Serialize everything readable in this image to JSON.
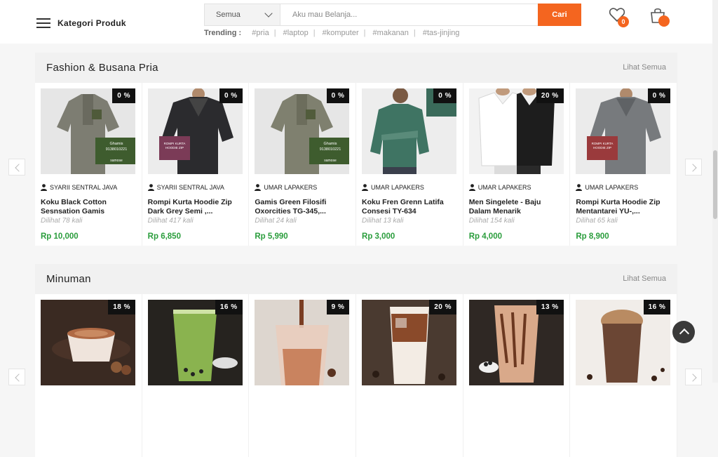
{
  "header": {
    "category_label": "Kategori Produk",
    "search_category": "Semua",
    "search_placeholder": "Aku mau Belanja...",
    "search_button": "Cari",
    "trending_label": "Trending :",
    "trending_tags": [
      "#pria",
      "#laptop",
      "#komputer",
      "#makanan",
      "#tas-jinjing"
    ],
    "wishlist_count": "0",
    "cart_count": ""
  },
  "sections": [
    {
      "title": "Fashion & Busana Pria",
      "see_all": "Lihat Semua",
      "products": [
        {
          "discount": "0 %",
          "seller": "SYARII SENTRAL JAVA",
          "name": "Koku Black Cotton Sesnsation Gamis",
          "views": "Dilihat 78 kali",
          "price": "Rp 10,000"
        },
        {
          "discount": "0 %",
          "seller": "SYARII SENTRAL JAVA",
          "name": "Rompi Kurta Hoodie Zip Dark Grey Semi ,...",
          "views": "Dilihat 417 kali",
          "price": "Rp 6,850"
        },
        {
          "discount": "0 %",
          "seller": "UMAR LAPAKERS",
          "name": "Gamis Green Filosifi Oxorcities TG-345,...",
          "views": "Dilihat 24 kali",
          "price": "Rp 5,990"
        },
        {
          "discount": "0 %",
          "seller": "UMAR LAPAKERS",
          "name": "Koku Fren Grenn Latifa Consesi TY-634",
          "views": "Dilihat 13 kali",
          "price": "Rp 3,000"
        },
        {
          "discount": "20 %",
          "seller": "UMAR LAPAKERS",
          "name": "Men Singelete - Baju Dalam Menarik",
          "views": "Dilihat 154 kali",
          "price": "Rp 4,000"
        },
        {
          "discount": "0 %",
          "seller": "UMAR LAPAKERS",
          "name": "Rompi Kurta Hoodie Zip Mentantarei YU-,...",
          "views": "Dilihat 65 kali",
          "price": "Rp 8,900"
        }
      ]
    },
    {
      "title": "Minuman",
      "see_all": "Lihat Semua",
      "products": [
        {
          "discount": "18 %"
        },
        {
          "discount": "16 %"
        },
        {
          "discount": "9 %"
        },
        {
          "discount": "20 %"
        },
        {
          "discount": "13 %"
        },
        {
          "discount": "16 %"
        }
      ]
    }
  ],
  "image_labels": {
    "ghamis_name": "Ghamis",
    "ghamis_code": "9138010221",
    "ghamis_brand": "samose",
    "rompi_line1": "ROMPI KURTA",
    "rompi_line2": "HOODIE ZIP"
  },
  "colors": {
    "accent": "#f4651f",
    "price": "#2a9d3c",
    "discount_bg": "#111111"
  }
}
